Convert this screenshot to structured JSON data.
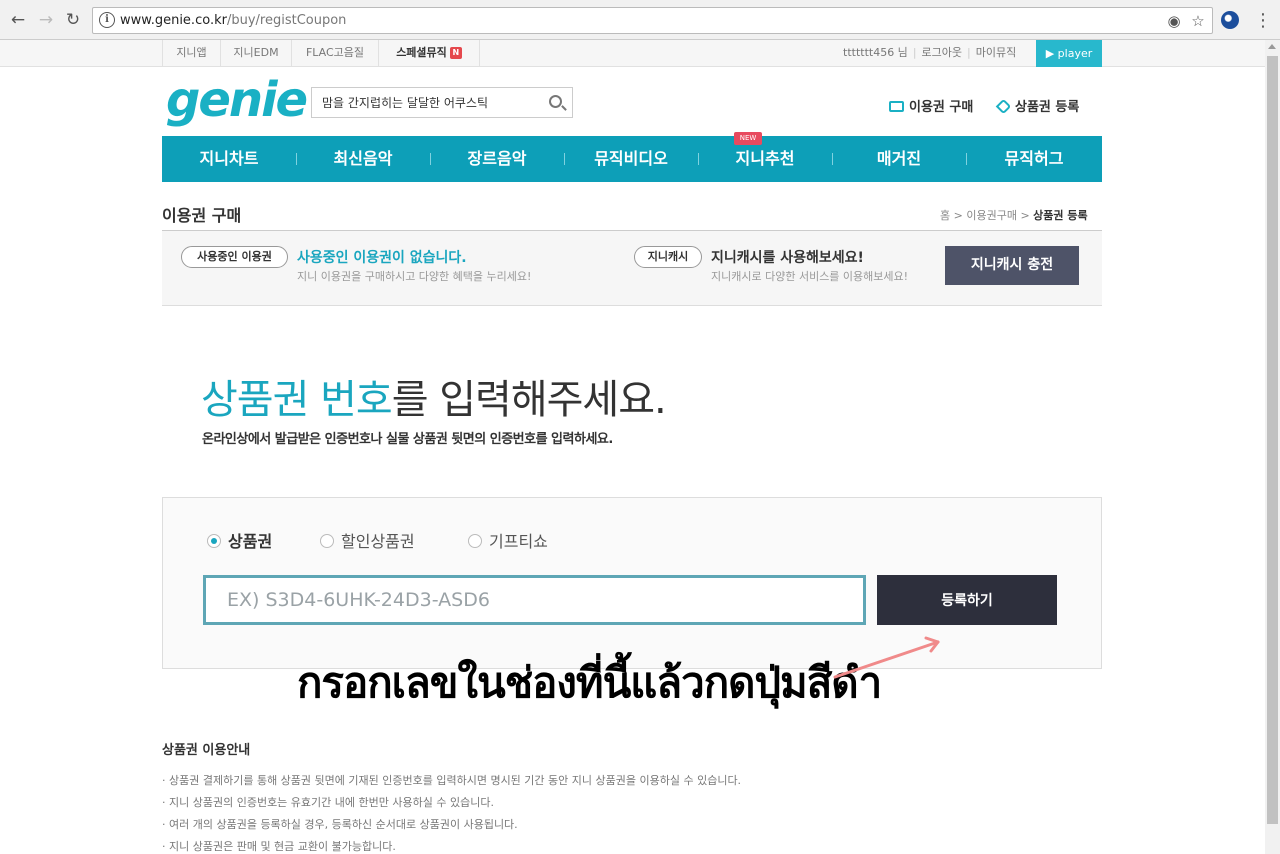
{
  "browser": {
    "url_host": "www.genie.co.kr",
    "url_path": "/buy/registCoupon"
  },
  "topbar": {
    "items": [
      "지니앱",
      "지니EDM",
      "FLAC고음질",
      "스페셜뮤직"
    ],
    "user": "ttttttt456 님",
    "logout": "로그아웃",
    "mymusic": "마이뮤직",
    "player": "▶ player"
  },
  "header": {
    "logo": "genie",
    "search_value": "맘을 간지럽히는 달달한 어쿠스틱",
    "buy_link": "이용권 구매",
    "coupon_link": "상품권 등록"
  },
  "gnb": {
    "items": [
      "지니차트",
      "최신음악",
      "장르음악",
      "뮤직비디오",
      "지니추천",
      "매거진",
      "뮤직허그"
    ],
    "new_badge": "NEW"
  },
  "page": {
    "title": "이용권 구매",
    "breadcrumb": [
      "홈",
      "이용권구매",
      "상품권 등록"
    ]
  },
  "info": {
    "pill1": "사용중인 이용권",
    "title1": "사용중인 이용권이 없습니다.",
    "sub1": "지니 이용권을 구매하시고 다양한 혜택을 누리세요!",
    "pill2": "지니캐시",
    "title2": "지니캐시를 사용해보세요!",
    "sub2": "지니캐시로 다양한 서비스를 이용해보세요!",
    "cash_button": "지니캐시 충전"
  },
  "hero": {
    "accent": "상품권 번호",
    "rest": "를 입력해주세요.",
    "sub": "온라인상에서 발급받은 인증번호나 실물 상품권 뒷면의 인증번호를 입력하세요."
  },
  "register": {
    "radios": [
      "상품권",
      "할인상품권",
      "기프티쇼"
    ],
    "selected": 0,
    "input_placeholder": "EX) S3D4-6UHK-24D3-ASD6",
    "button": "등록하기"
  },
  "annotation": {
    "text": "กรอกเลขในช่องที่นี้แล้วกดปุ่มสีดำ",
    "arrow_color": "#f08a8a"
  },
  "guide": {
    "title": "상품권 이용안내",
    "items": [
      "· 상품권 결제하기를 통해 상품권 뒷면에 기재된 인증번호를 입력하시면 명시된 기간 동안 지니 상품권을 이용하실 수 있습니다.",
      "· 지니 상품권의 인증번호는 유효기간 내에 한번만 사용하실 수 있습니다.",
      "· 여러 개의 상품권을 등록하실 경우, 등록하신 순서대로 상품권이 사용됩니다.",
      "· 지니 상품권은 판매 및 현금 교환이 불가능합니다."
    ]
  },
  "colors": {
    "brand": "#1ab0c4",
    "gnb": "#0d9fb8",
    "dark_button": "#2d2f3c",
    "cash_button": "#4e5368"
  }
}
